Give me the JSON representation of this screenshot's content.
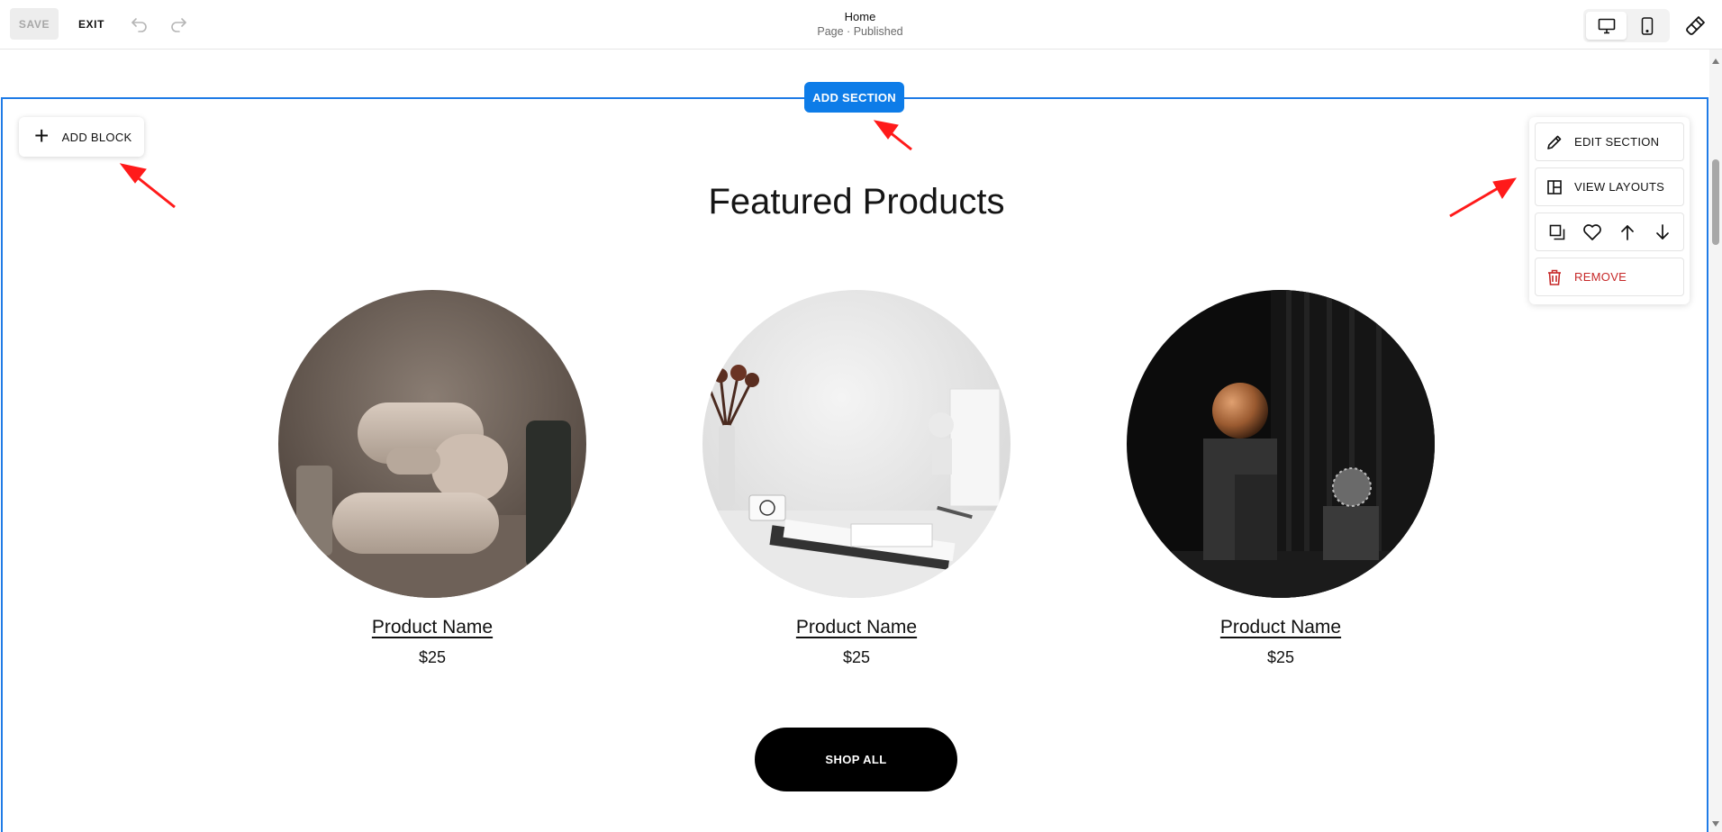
{
  "toolbar": {
    "save_label": "SAVE",
    "exit_label": "EXIT",
    "page_title": "Home",
    "page_status": "Page · Published"
  },
  "section": {
    "add_section_label": "ADD SECTION",
    "add_block_label": "ADD BLOCK",
    "heading": "Featured Products",
    "products": [
      {
        "name": "Product Name",
        "price": "$25"
      },
      {
        "name": "Product Name",
        "price": "$25"
      },
      {
        "name": "Product Name",
        "price": "$25"
      }
    ],
    "shop_all_label": "SHOP ALL"
  },
  "section_menu": {
    "edit_label": "EDIT SECTION",
    "layouts_label": "VIEW LAYOUTS",
    "remove_label": "REMOVE"
  },
  "colors": {
    "accent": "#0d7ce8",
    "section_border": "#1f7be6",
    "remove": "#c62828",
    "annotation": "#ff1a1a"
  },
  "icons": [
    "undo-icon",
    "redo-icon",
    "desktop-icon",
    "mobile-icon",
    "paintbrush-icon",
    "plus-icon",
    "pencil-icon",
    "layout-icon",
    "duplicate-icon",
    "heart-icon",
    "arrow-up-icon",
    "arrow-down-icon",
    "trash-icon"
  ]
}
